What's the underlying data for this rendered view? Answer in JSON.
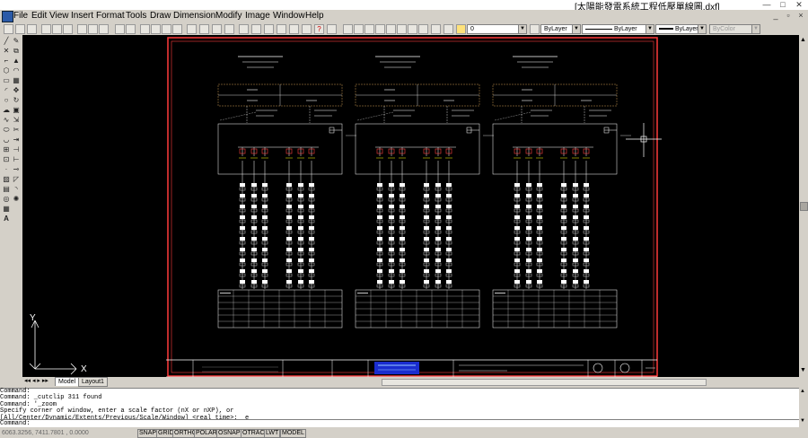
{
  "window": {
    "title": "[太陽能發電系統工程低壓單線圖.dxf]"
  },
  "menu": [
    "File",
    "Edit",
    "View",
    "Insert",
    "Format",
    "Tools",
    "Draw",
    "Dimension",
    "Modify",
    "Image",
    "Window",
    "Help"
  ],
  "toolbar": {
    "layer_value": "0",
    "color_value": "ByLayer",
    "linetype_value": "ByLayer",
    "lineweight_value": "ByLayer",
    "plotstyle_value": "ByColor"
  },
  "tabs": [
    {
      "label": "Model",
      "active": true
    },
    {
      "label": "Layout1",
      "active": false
    }
  ],
  "command_history": [
    "Command:",
    "Command: _cutclip 311 found",
    "Command: '_zoom",
    "Specify corner of window, enter a scale factor (nX or nXP), or",
    "[All/Center/Dynamic/Extents/Previous/Scale/Window] <real time>: _e"
  ],
  "command_prompt": "Command:",
  "status": {
    "coordinates": "6063.3256, 7411.7801 , 0.0000",
    "toggles": [
      "SNAP",
      "GRID",
      "ORTHO",
      "POLAR",
      "OSNAP",
      "OTRACK",
      "LWT",
      "MODEL"
    ]
  },
  "ucs": {
    "y_label": "Y",
    "x_label": "X"
  },
  "colors": {
    "canvas": "#000000",
    "border": "#ff3b3b",
    "lines": "#ffffff",
    "title_band": "#1a2dcf",
    "accent": "#ffff00"
  }
}
